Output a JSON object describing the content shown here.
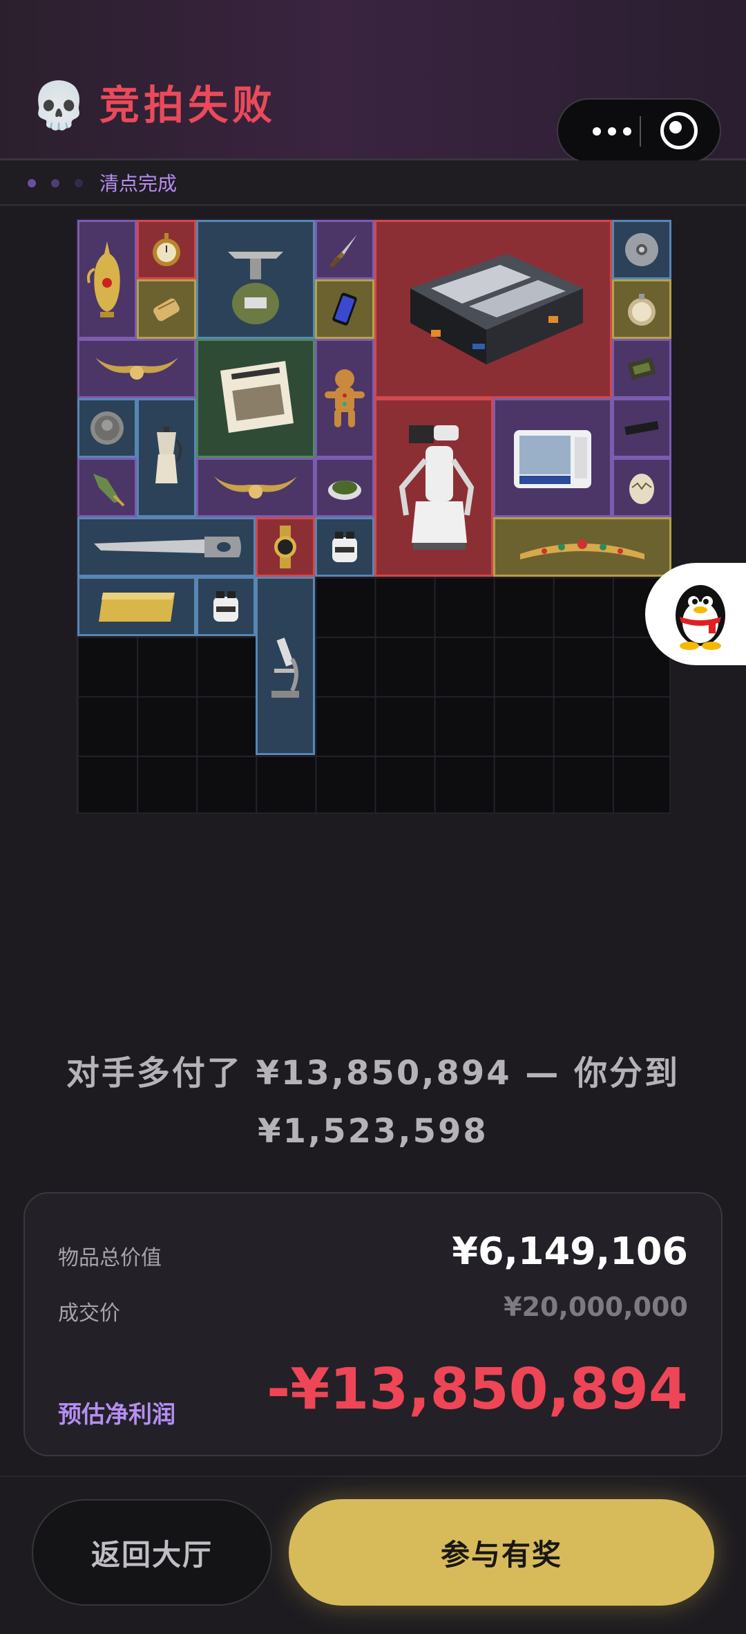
{
  "header": {
    "icon": "skull-icon",
    "title": "竞拍失败",
    "status": "清点完成",
    "progress_colors": [
      "#6b4fa3",
      "#4f3d78",
      "#35294e"
    ]
  },
  "capsule": {
    "more_icon": "more-dots-icon",
    "close_icon": "target-circle-icon"
  },
  "inventory": {
    "columns": 10,
    "rows": 10,
    "items": [
      {
        "name": "gold-ewer",
        "rarity": "purple"
      },
      {
        "name": "pocket-watch",
        "rarity": "red"
      },
      {
        "name": "camping-stove",
        "rarity": "blue"
      },
      {
        "name": "dagger",
        "rarity": "purple"
      },
      {
        "name": "armored-case",
        "rarity": "red"
      },
      {
        "name": "silver-disc",
        "rarity": "blue"
      },
      {
        "name": "brass-cylinder",
        "rarity": "gold"
      },
      {
        "name": "smartphone",
        "rarity": "gold"
      },
      {
        "name": "compass",
        "rarity": "gold"
      },
      {
        "name": "horned-ornament",
        "rarity": "purple"
      },
      {
        "name": "newspaper",
        "rarity": "green"
      },
      {
        "name": "gingerbread-man",
        "rarity": "purple"
      },
      {
        "name": "circuit-chip",
        "rarity": "purple"
      },
      {
        "name": "ancient-coin",
        "rarity": "blue"
      },
      {
        "name": "moka-pot",
        "rarity": "blue"
      },
      {
        "name": "service-robot",
        "rarity": "red"
      },
      {
        "name": "lab-incubator",
        "rarity": "purple"
      },
      {
        "name": "black-bar",
        "rarity": "purple"
      },
      {
        "name": "spear-tip",
        "rarity": "purple"
      },
      {
        "name": "horned-ornament-2",
        "rarity": "purple"
      },
      {
        "name": "herb-dish",
        "rarity": "purple"
      },
      {
        "name": "cracked-egg",
        "rarity": "purple"
      },
      {
        "name": "hand-saw",
        "rarity": "blue"
      },
      {
        "name": "gold-watch",
        "rarity": "red"
      },
      {
        "name": "sample-jar",
        "rarity": "blue"
      },
      {
        "name": "jeweled-tiara",
        "rarity": "gold"
      },
      {
        "name": "gold-bar",
        "rarity": "blue"
      },
      {
        "name": "sample-jar-2",
        "rarity": "blue"
      },
      {
        "name": "microscope",
        "rarity": "blue"
      }
    ]
  },
  "summary": {
    "line1": "对手多付了 ¥13,850,894 — 你分到",
    "line2": "¥1,523,598"
  },
  "card": {
    "total_label": "物品总价值",
    "total_value": "¥6,149,106",
    "price_label": "成交价",
    "price_value": "¥20,000,000",
    "profit_label": "预估净利润",
    "profit_value": "-¥13,850,894"
  },
  "buttons": {
    "back": "返回大厅",
    "reward": "参与有奖"
  },
  "float_icon": "qq-penguin-icon"
}
